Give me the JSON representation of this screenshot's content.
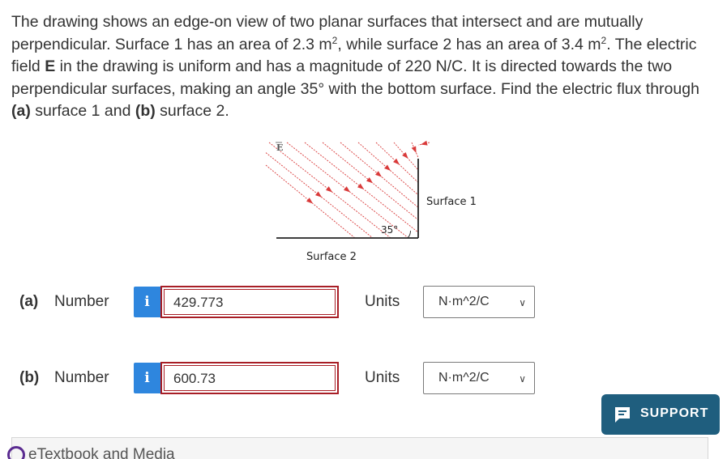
{
  "problem": {
    "line1": "The drawing shows an edge-on view of two planar surfaces that intersect and are mutually",
    "line2_a": "perpendicular. Surface 1 has an area of 2.3 m",
    "line2_sup1": "2",
    "line2_b": ", while surface 2 has an area of 3.4 m",
    "line2_sup2": "2",
    "line2_c": ". The electric",
    "line3_a": "field ",
    "line3_bold": "E",
    "line3_b": " in the drawing is uniform and has a magnitude of 220 N/C. It is directed towards the two",
    "line4": "perpendicular surfaces, making an angle 35° with the bottom surface. Find the electric flux through",
    "line5_a_bold": "(a)",
    "line5_a": " surface 1 and ",
    "line5_b_bold": "(b)",
    "line5_b": " surface 2."
  },
  "figure": {
    "field_label": "E",
    "surface1_label": "Surface 1",
    "surface2_label": "Surface 2",
    "angle_label": "35°"
  },
  "part_a": {
    "part_label": "(a)",
    "number_label": "Number",
    "info_icon": "i",
    "value": "429.773",
    "units_label": "Units",
    "units_value": "N·m^2/C"
  },
  "part_b": {
    "part_label": "(b)",
    "number_label": "Number",
    "info_icon": "i",
    "value": "600.73",
    "units_label": "Units",
    "units_value": "N·m^2/C"
  },
  "support": {
    "label": "SUPPORT"
  },
  "etextbook": {
    "label": "eTextbook and Media"
  },
  "colors": {
    "info_blue": "#2e86de",
    "error_red": "#a81e26",
    "support_bg": "#1f5e7e",
    "arrow_red": "#d93a3a"
  }
}
